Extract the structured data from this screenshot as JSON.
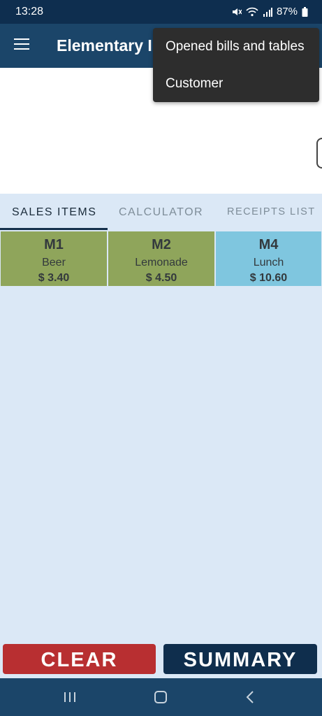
{
  "status_bar": {
    "time": "13:28",
    "battery": "87%"
  },
  "app_bar": {
    "title": "Elementary I"
  },
  "menu": {
    "items": [
      "Opened bills and tables",
      "Customer"
    ]
  },
  "tabs": [
    "SALES ITEMS",
    "CALCULATOR",
    "RECEIPTS LIST"
  ],
  "active_tab": "SALES ITEMS",
  "sales_items": [
    {
      "code": "M1",
      "name": "Beer",
      "price": "$ 3.40",
      "color": "#8fa55b"
    },
    {
      "code": "M2",
      "name": "Lemonade",
      "price": "$ 4.50",
      "color": "#8fa55b"
    },
    {
      "code": "M4",
      "name": "Lunch",
      "price": "$ 10.60",
      "color": "#7fc6df"
    }
  ],
  "buttons": {
    "clear": "CLEAR",
    "summary": "SUMMARY"
  },
  "colors": {
    "app_bar": "#1b4569",
    "status_bar": "#0e2e4f",
    "clear": "#b82f31",
    "summary": "#0f2e4d",
    "background": "#dbe8f6"
  },
  "icons": [
    "mute-icon",
    "wifi-icon",
    "signal-icon",
    "battery-icon",
    "menu-icon",
    "recent-apps-icon",
    "home-icon",
    "back-icon"
  ]
}
